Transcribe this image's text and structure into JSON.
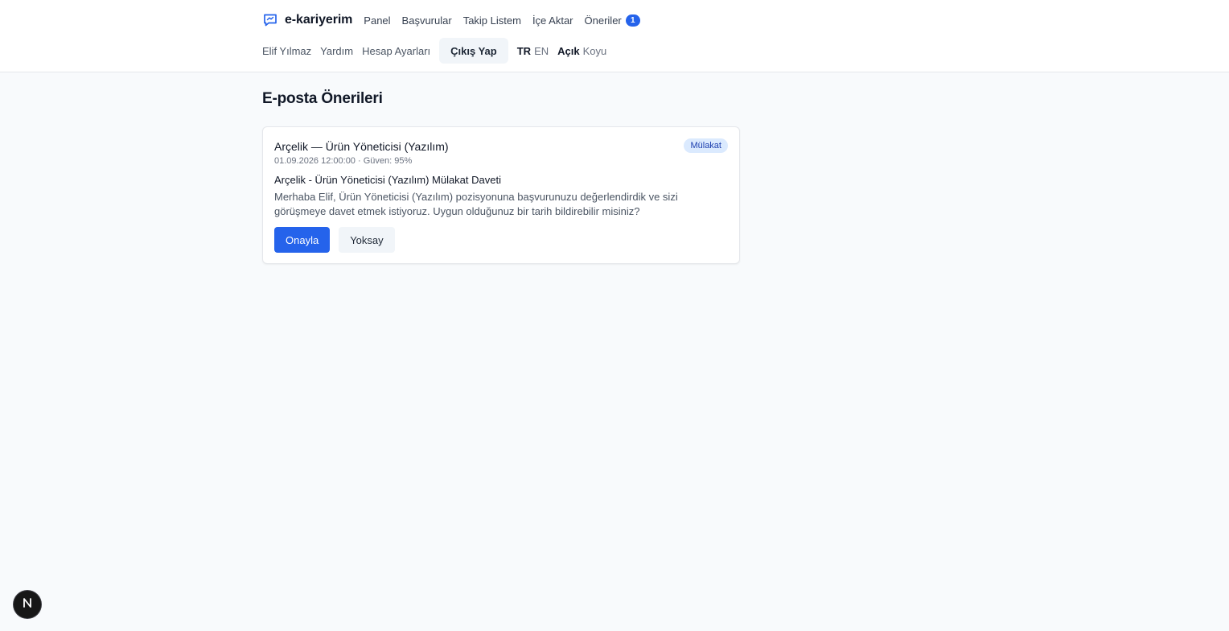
{
  "brand": {
    "name": "e-kariyerim",
    "icon": "chat-message-icon",
    "accent": "#2563eb"
  },
  "nav": {
    "items": [
      {
        "label": "Panel"
      },
      {
        "label": "Başvurular"
      },
      {
        "label": "Takip Listem"
      },
      {
        "label": "İçe Aktar"
      }
    ],
    "suggestions": {
      "label": "Öneriler",
      "count": "1"
    }
  },
  "account": {
    "user": "Elif Yılmaz",
    "help": "Yardım",
    "settings": "Hesap Ayarları",
    "logout": "Çıkış Yap"
  },
  "language": {
    "active": "TR",
    "inactive": "EN"
  },
  "theme": {
    "active": "Açık",
    "inactive": "Koyu"
  },
  "page": {
    "title": "E-posta Önerileri"
  },
  "suggestion": {
    "title": "Arçelik — Ürün Yöneticisi (Yazılım)",
    "tag": "Mülakat",
    "meta": "01.09.2026 12:00:00 · Güven: 95%",
    "subject": "Arçelik - Ürün Yöneticisi (Yazılım) Mülakat Daveti",
    "body": "Merhaba Elif, Ürün Yöneticisi (Yazılım) pozisyonuna başvurunuzu değerlendirdik ve sizi görüşmeye davet etmek istiyoruz. Uygun olduğunuz bir tarih bildirebilir misiniz?",
    "approve": "Onayla",
    "dismiss": "Yoksay"
  },
  "dev_indicator": {
    "icon": "nextjs-logo-icon",
    "letter": "N"
  }
}
